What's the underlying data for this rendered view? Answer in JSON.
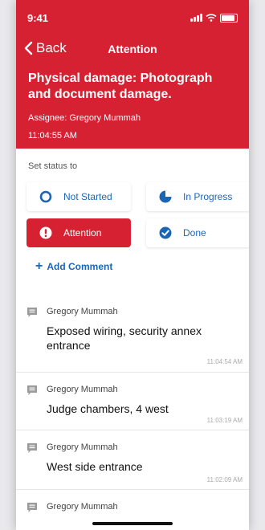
{
  "statusbar": {
    "time": "9:41"
  },
  "nav": {
    "back_label": "Back",
    "title": "Attention"
  },
  "incident": {
    "title": "Physical damage: Photograph and document damage.",
    "assignee": "Assignee: Gregory Mummah",
    "time": "11:04:55 AM"
  },
  "status": {
    "heading": "Set status to",
    "options": [
      {
        "label": "Not Started",
        "icon": "empty-circle-icon",
        "selected": false
      },
      {
        "label": "In Progress",
        "icon": "clock-icon",
        "selected": false
      },
      {
        "label": "Attention",
        "icon": "exclamation-icon",
        "selected": true
      },
      {
        "label": "Done",
        "icon": "check-circle-icon",
        "selected": false
      }
    ],
    "add_comment": "Add Comment"
  },
  "comments": [
    {
      "author": "Gregory Mummah",
      "text": "Exposed wiring, security annex entrance",
      "time": "11:04:54 AM"
    },
    {
      "author": "Gregory Mummah",
      "text": "Judge chambers, 4 west",
      "time": "11:03:19 AM"
    },
    {
      "author": "Gregory Mummah",
      "text": "West side entrance",
      "time": "11:02:09 AM"
    },
    {
      "author": "Gregory Mummah",
      "text": "",
      "time": ""
    }
  ],
  "colors": {
    "brand": "#d62132",
    "link": "#1a66b5"
  }
}
